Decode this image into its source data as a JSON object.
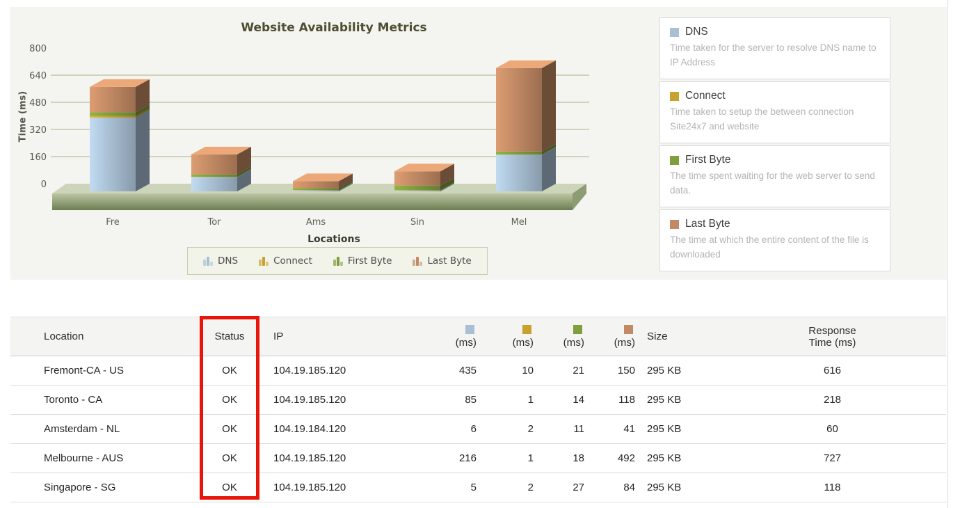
{
  "chart": {
    "title": "Website Availability Metrics",
    "y_axis_label": "Time (ms)",
    "x_axis_label": "Locations"
  },
  "chart_data": {
    "type": "bar",
    "stacked": true,
    "style": "3d",
    "title": "Website Availability Metrics",
    "xlabel": "Locations",
    "ylabel": "Time (ms)",
    "ylim": [
      0,
      800
    ],
    "y_ticks": [
      800,
      640,
      480,
      320,
      160,
      0
    ],
    "grid": true,
    "legend_position": "bottom",
    "categories": [
      "Fre",
      "Tor",
      "Ams",
      "Sin",
      "Mel"
    ],
    "series": [
      {
        "name": "DNS",
        "color": "#a9c0d4",
        "values": [
          435,
          85,
          6,
          5,
          216
        ]
      },
      {
        "name": "Connect",
        "color": "#c7a22e",
        "values": [
          10,
          1,
          2,
          2,
          1
        ]
      },
      {
        "name": "First Byte",
        "color": "#7f9e3c",
        "values": [
          21,
          14,
          11,
          27,
          18
        ]
      },
      {
        "name": "Last Byte",
        "color": "#c28a64",
        "values": [
          150,
          118,
          41,
          84,
          492
        ]
      }
    ],
    "totals": [
      616,
      218,
      60,
      118,
      727
    ]
  },
  "info_cards": [
    {
      "title": "DNS",
      "color": "#a9c0d4",
      "description": "Time taken for the server to resolve DNS name to IP Address"
    },
    {
      "title": "Connect",
      "color": "#c7a22e",
      "description": "Time taken to setup the between connection Site24x7 and website"
    },
    {
      "title": "First Byte",
      "color": "#7f9e3c",
      "description": "The time spent waiting for the web server to send data."
    },
    {
      "title": "Last Byte",
      "color": "#c28a64",
      "description": "The time at which the entire content of the file is downloaded"
    }
  ],
  "table": {
    "header": {
      "location": "Location",
      "status": "Status",
      "ip": "IP",
      "ms": "(ms)",
      "size": "Size",
      "response_line1": "Response",
      "response_line2": "Time (ms)"
    },
    "rows": [
      {
        "location": "Fremont-CA - US",
        "status": "OK",
        "ip": "104.19.185.120",
        "dns": "435",
        "connect": "10",
        "first_byte": "21",
        "last_byte": "150",
        "size": "295 KB",
        "response": "616"
      },
      {
        "location": "Toronto - CA",
        "status": "OK",
        "ip": "104.19.185.120",
        "dns": "85",
        "connect": "1",
        "first_byte": "14",
        "last_byte": "118",
        "size": "295 KB",
        "response": "218"
      },
      {
        "location": "Amsterdam - NL",
        "status": "OK",
        "ip": "104.19.184.120",
        "dns": "6",
        "connect": "2",
        "first_byte": "11",
        "last_byte": "41",
        "size": "295 KB",
        "response": "60"
      },
      {
        "location": "Melbourne - AUS",
        "status": "OK",
        "ip": "104.19.185.120",
        "dns": "216",
        "connect": "1",
        "first_byte": "18",
        "last_byte": "492",
        "size": "295 KB",
        "response": "727"
      },
      {
        "location": "Singapore - SG",
        "status": "OK",
        "ip": "104.19.185.120",
        "dns": "5",
        "connect": "2",
        "first_byte": "27",
        "last_byte": "84",
        "size": "295 KB",
        "response": "118"
      }
    ]
  },
  "annotation": {
    "highlighted_column": "Status",
    "box_color": "#e9150b"
  }
}
